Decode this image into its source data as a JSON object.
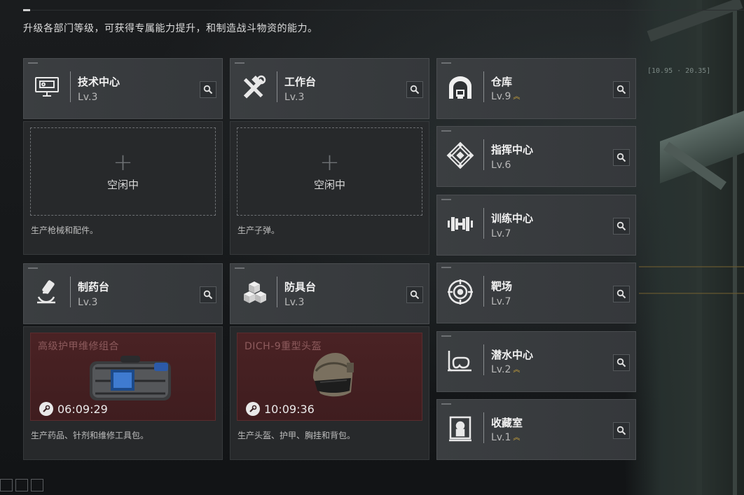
{
  "header": {
    "subtitle": "升级各部门等级，可获得专属能力提升，和制造战斗物资的能力。"
  },
  "hud": {
    "readout": "[10.95 · 20.35]"
  },
  "departments": [
    {
      "name": "技术中心",
      "level": "Lv.3",
      "icon": "computer-icon"
    },
    {
      "name": "工作台",
      "level": "Lv.3",
      "icon": "tools-icon"
    },
    {
      "name": "制药台",
      "level": "Lv.3",
      "icon": "microscope-icon"
    },
    {
      "name": "防具台",
      "level": "Lv.3",
      "icon": "cubes-icon"
    },
    {
      "name": "仓库",
      "level": "Lv.9",
      "icon": "warehouse-icon",
      "upgradable": true
    },
    {
      "name": "指挥中心",
      "level": "Lv.6",
      "icon": "command-icon"
    },
    {
      "name": "训练中心",
      "level": "Lv.7",
      "icon": "dumbbell-icon"
    },
    {
      "name": "靶场",
      "level": "Lv.7",
      "icon": "target-icon"
    },
    {
      "name": "潜水中心",
      "level": "Lv.2",
      "icon": "diving-mask-icon",
      "upgradable": true
    },
    {
      "name": "收藏室",
      "level": "Lv.1",
      "icon": "display-case-icon",
      "upgradable": true
    }
  ],
  "production": {
    "tech": {
      "status": "空闲中",
      "desc": "生产枪械和配件。"
    },
    "workbench": {
      "status": "空闲中",
      "desc": "生产子弹。"
    },
    "pharmacy": {
      "item": "高级护甲维修组合",
      "time": "06:09:29",
      "desc": "生产药品、针剂和维修工具包。"
    },
    "armor": {
      "item": "DICH-9重型头盔",
      "time": "10:09:36",
      "desc": "生产头盔、护甲、胸挂和背包。"
    }
  },
  "colors": {
    "upgrade": "#c9a33b",
    "production_bg": "#4a2224"
  }
}
